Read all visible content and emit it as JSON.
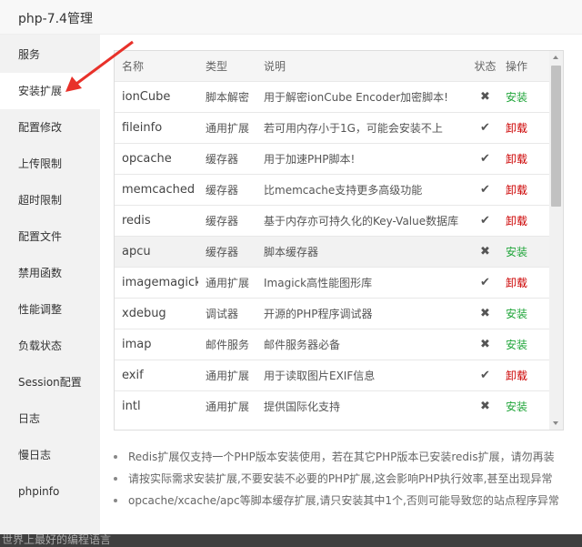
{
  "window": {
    "title": "php-7.4管理"
  },
  "sidebar": {
    "active_index": 1,
    "items": [
      {
        "label": "服务"
      },
      {
        "label": "安装扩展"
      },
      {
        "label": "配置修改"
      },
      {
        "label": "上传限制"
      },
      {
        "label": "超时限制"
      },
      {
        "label": "配置文件"
      },
      {
        "label": "禁用函数"
      },
      {
        "label": "性能调整"
      },
      {
        "label": "负载状态"
      },
      {
        "label": "Session配置"
      },
      {
        "label": "日志"
      },
      {
        "label": "慢日志"
      },
      {
        "label": "phpinfo"
      }
    ]
  },
  "table": {
    "headers": {
      "name": "名称",
      "type": "类型",
      "desc": "说明",
      "status": "状态",
      "op": "操作"
    },
    "rows": [
      {
        "name": "ionCube",
        "type": "脚本解密",
        "desc": "用于解密ionCube Encoder加密脚本!",
        "status": "✖",
        "status_icon": "cross-icon",
        "op": "安装",
        "op_color": "#20a53a"
      },
      {
        "name": "fileinfo",
        "type": "通用扩展",
        "desc": "若可用内存小于1G，可能会安装不上",
        "status": "✔",
        "status_icon": "check-icon",
        "op": "卸载",
        "op_color": "#cc0000"
      },
      {
        "name": "opcache",
        "type": "缓存器",
        "desc": "用于加速PHP脚本!",
        "status": "✔",
        "status_icon": "check-icon",
        "op": "卸载",
        "op_color": "#cc0000"
      },
      {
        "name": "memcached",
        "type": "缓存器",
        "desc": "比memcache支持更多高级功能",
        "status": "✔",
        "status_icon": "check-icon",
        "op": "卸载",
        "op_color": "#cc0000"
      },
      {
        "name": "redis",
        "type": "缓存器",
        "desc": "基于内存亦可持久化的Key-Value数据库",
        "status": "✔",
        "status_icon": "check-icon",
        "op": "卸载",
        "op_color": "#cc0000"
      },
      {
        "name": "apcu",
        "type": "缓存器",
        "desc": "脚本缓存器",
        "status": "✖",
        "status_icon": "cross-icon",
        "op": "安装",
        "op_color": "#20a53a"
      },
      {
        "name": "imagemagick",
        "type": "通用扩展",
        "desc": "Imagick高性能图形库",
        "status": "✔",
        "status_icon": "check-icon",
        "op": "卸载",
        "op_color": "#cc0000"
      },
      {
        "name": "xdebug",
        "type": "调试器",
        "desc": "开源的PHP程序调试器",
        "status": "✖",
        "status_icon": "cross-icon",
        "op": "安装",
        "op_color": "#20a53a"
      },
      {
        "name": "imap",
        "type": "邮件服务",
        "desc": "邮件服务器必备",
        "status": "✖",
        "status_icon": "cross-icon",
        "op": "安装",
        "op_color": "#20a53a"
      },
      {
        "name": "exif",
        "type": "通用扩展",
        "desc": "用于读取图片EXIF信息",
        "status": "✔",
        "status_icon": "check-icon",
        "op": "卸载",
        "op_color": "#cc0000"
      },
      {
        "name": "intl",
        "type": "通用扩展",
        "desc": "提供国际化支持",
        "status": "✖",
        "status_icon": "cross-icon",
        "op": "安装",
        "op_color": "#20a53a"
      }
    ]
  },
  "notes": [
    "Redis扩展仅支持一个PHP版本安装使用，若在其它PHP版本已安装redis扩展，请勿再装",
    "请按实际需求安装扩展,不要安装不必要的PHP扩展,这会影响PHP执行效率,甚至出现异常",
    "opcache/xcache/apc等脚本缓存扩展,请只安装其中1个,否则可能导致您的站点程序异常"
  ],
  "background_text": "世界上最好的编程语言",
  "colors": {
    "install": "#20a53a",
    "uninstall": "#cc0000",
    "arrow": "#e8312a"
  }
}
